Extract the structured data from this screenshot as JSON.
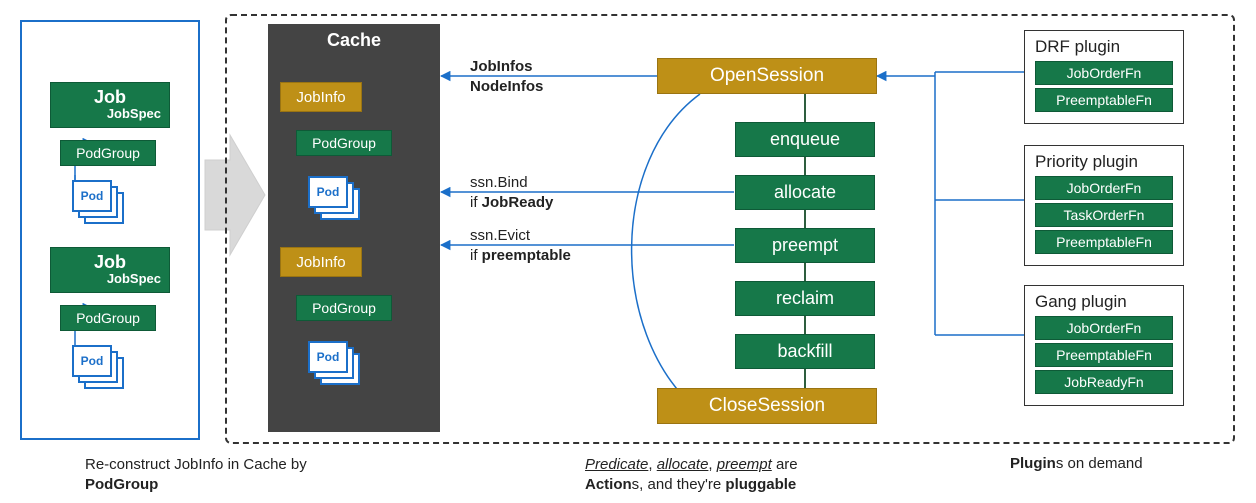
{
  "left": {
    "job_label": "Job",
    "jobspec_label": "JobSpec",
    "podgroup_label": "PodGroup",
    "pod_label": "Pod"
  },
  "cache": {
    "title": "Cache",
    "jobinfo_label": "JobInfo",
    "podgroup_label": "PodGroup",
    "pod_label": "Pod"
  },
  "flow": {
    "edge1a": "JobInfos",
    "edge1b": "NodeInfos",
    "edge2a": "ssn.Bind",
    "edge2b_prefix": "if ",
    "edge2b_bold": "JobReady",
    "edge3a": "ssn.Evict",
    "edge3b_prefix": "if ",
    "edge3b_bold": "preemptable"
  },
  "pipeline": {
    "open": "OpenSession",
    "close": "CloseSession",
    "actions": {
      "a1": "enqueue",
      "a2": "allocate",
      "a3": "preempt",
      "a4": "reclaim",
      "a5": "backfill"
    }
  },
  "plugins": {
    "drf": {
      "title": "DRF plugin",
      "fn1": "JobOrderFn",
      "fn2": "PreemptableFn"
    },
    "priority": {
      "title": "Priority plugin",
      "fn1": "JobOrderFn",
      "fn2": "TaskOrderFn",
      "fn3": "PreemptableFn"
    },
    "gang": {
      "title": "Gang plugin",
      "fn1": "JobOrderFn",
      "fn2": "PreemptableFn",
      "fn3": "JobReadyFn"
    }
  },
  "captions": {
    "c1_line1": "Re-construct JobInfo in Cache by",
    "c1_bold": "PodGroup",
    "c2_italic1": "Predicate",
    "c2_italic2": "allocate",
    "c2_italic3": "preempt",
    "c2_after_italics": " are",
    "c2_bold1": "Action",
    "c2_mid": "s, and they're ",
    "c2_bold2": "pluggable",
    "c3_bold": "Plugin",
    "c3_rest": "s on demand"
  }
}
